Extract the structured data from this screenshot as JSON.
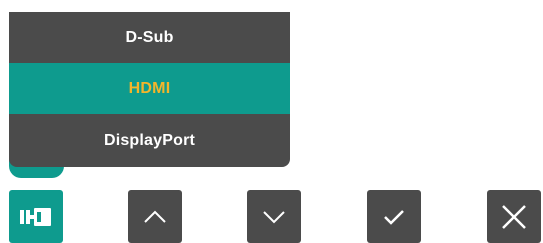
{
  "menu": {
    "items": [
      {
        "label": "D-Sub",
        "selected": false
      },
      {
        "label": "HDMI",
        "selected": true
      },
      {
        "label": "DisplayPort",
        "selected": false
      }
    ]
  },
  "buttons": {
    "source_icon": "input-source-icon",
    "up_icon": "chevron-up-icon",
    "down_icon": "chevron-down-icon",
    "confirm_icon": "checkmark-icon",
    "close_icon": "close-icon"
  },
  "colors": {
    "menu_bg": "#4b4b4b",
    "accent": "#0e9b8e",
    "selected_text": "#f3b52b",
    "text": "#ffffff"
  }
}
